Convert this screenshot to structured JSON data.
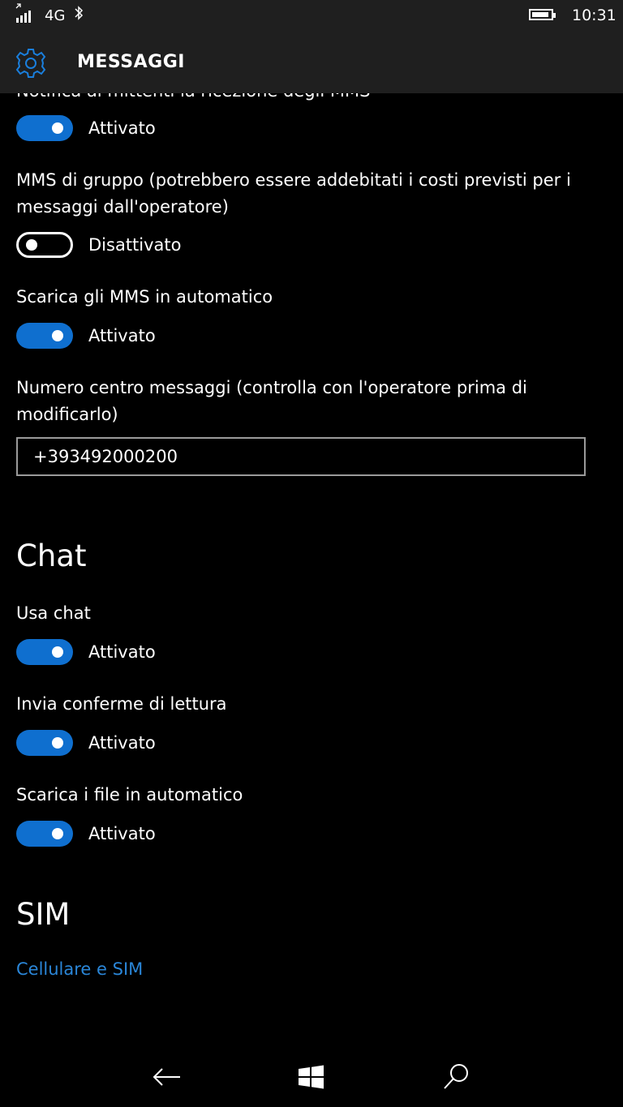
{
  "status": {
    "network": "4G",
    "bluetooth_icon": "bluetooth-icon",
    "time": "10:31",
    "battery_level": 0.9
  },
  "header": {
    "title": "MESSAGGI",
    "icon": "gear-icon",
    "accent": "#1a7fdd"
  },
  "settings": {
    "clipped_label": "Notifica ai mittenti la ricezione degli MMS",
    "mms_receipt": {
      "state": "Attivato",
      "on": true
    },
    "group_mms": {
      "label": "MMS di gruppo (potrebbero essere addebitati i costi previsti per i messaggi dall'operatore)",
      "state": "Disattivato",
      "on": false
    },
    "auto_mms": {
      "label": "Scarica gli MMS in automatico",
      "state": "Attivato",
      "on": true
    },
    "smsc": {
      "label": "Numero centro messaggi (controlla con l'operatore prima di modificarlo)",
      "value": "+393492000200"
    }
  },
  "chat": {
    "title": "Chat",
    "use_chat": {
      "label": "Usa chat",
      "state": "Attivato",
      "on": true
    },
    "read_receipts": {
      "label": "Invia conferme di lettura",
      "state": "Attivato",
      "on": true
    },
    "auto_files": {
      "label": "Scarica i file in automatico",
      "state": "Attivato",
      "on": true
    }
  },
  "sim": {
    "title": "SIM",
    "link": "Cellulare e SIM"
  },
  "colors": {
    "toggle_on": "#0f6fcf",
    "link": "#2a86d8",
    "bar_bg": "#1f1f1f"
  },
  "navbar": {
    "back_icon": "back-arrow-icon",
    "windows_icon": "windows-logo-icon",
    "search_icon": "search-icon"
  }
}
